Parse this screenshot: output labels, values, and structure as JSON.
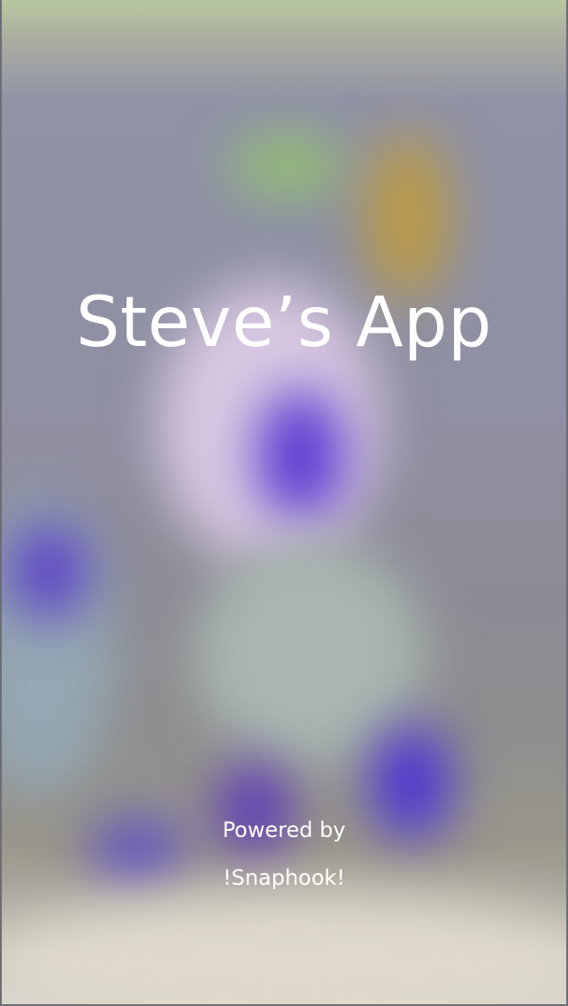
{
  "app": {
    "title": "Steve’s App",
    "powered_by": "Powered by",
    "brand": "!Snaphook!"
  },
  "colors": {
    "background_tint": "#8e8fa2",
    "text": "#ffffff"
  }
}
